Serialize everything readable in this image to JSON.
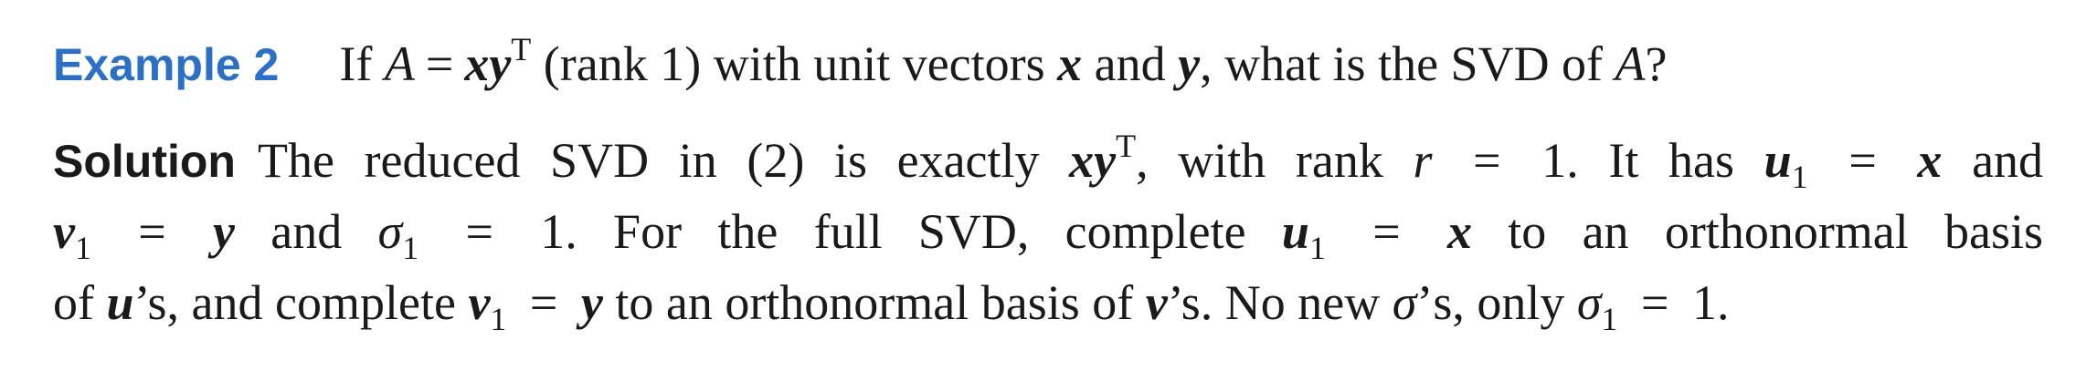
{
  "example": {
    "label": "Example 2",
    "text_1": "If ",
    "math_A": "A",
    "math_eq": "=",
    "math_xy": "xy",
    "math_T": "T",
    "text_2": " (rank 1) with unit vectors ",
    "math_x": "x",
    "text_3": " and ",
    "math_y": "y",
    "text_4": ", what is the SVD of ",
    "math_A2": "A",
    "text_5": "?"
  },
  "solution": {
    "label": "Solution",
    "line1": {
      "text_1": "The reduced SVD in (2) is exactly ",
      "math_xy": "xy",
      "math_T": "T",
      "text_2": ", with rank ",
      "math_r": "r",
      "math_eq": "=",
      "text_3": "1. It has ",
      "math_u": "u",
      "math_u_sub": "1",
      "math_eq2": "=",
      "math_x": "x",
      "text_4": "and"
    },
    "line2": {
      "math_v": "v",
      "math_v_sub": "1",
      "math_eq": "=",
      "math_y": "y",
      "text_1": " and ",
      "math_sigma": "σ",
      "math_sigma_sub": "1",
      "math_eq2": "=",
      "text_2": "1. For the full SVD, complete ",
      "math_u": "u",
      "math_u_sub": "1",
      "math_eq3": "=",
      "math_x": "x",
      "text_3": " to an orthonormal basis"
    },
    "line3": {
      "text_1": "of ",
      "math_u": "u",
      "text_2": "’s, and complete ",
      "math_v": "v",
      "math_v_sub": "1",
      "math_eq": "=",
      "math_y": "y",
      "text_3": " to an orthonormal basis of ",
      "math_v2": "v",
      "text_4": "’s. No new ",
      "math_sigma": "σ",
      "text_5": "’s, only ",
      "math_sigma2": "σ",
      "math_sigma2_sub": "1",
      "math_eq2": "=",
      "text_6": "1."
    }
  }
}
